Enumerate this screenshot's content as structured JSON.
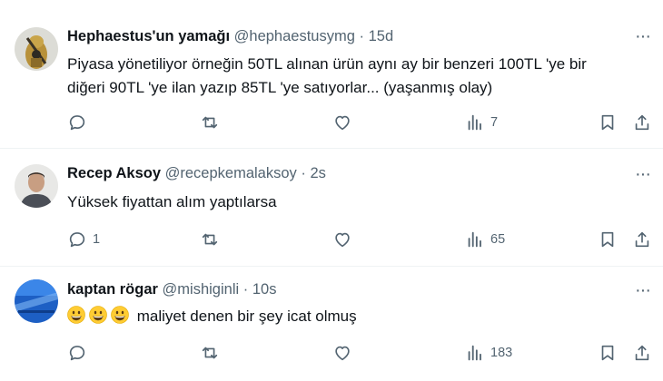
{
  "tweets": [
    {
      "name": "Hephaestus'un yamağı",
      "handle": "@hephaestusymg",
      "separator": "·",
      "time": "15d",
      "text_line1": "Piyasa yönetiliyor örneğin 50TL alınan ürün aynı ay bir benzeri 100TL 'ye bir",
      "text_line2": "diğeri 90TL 'ye ilan yazıp 85TL 'ye satıyorlar... (yaşanmış olay)",
      "replies": "",
      "reposts": "",
      "likes": "",
      "views": "7"
    },
    {
      "name": "Recep Aksoy",
      "handle": "@recepkemalaksoy",
      "separator": "·",
      "time": "2s",
      "text": "Yüksek fiyattan alım yaptılarsa",
      "replies": "1",
      "reposts": "",
      "likes": "",
      "views": "65"
    },
    {
      "name": "kaptan rögar",
      "handle": "@mishiginli",
      "separator": "·",
      "time": "10s",
      "emoji_count": 3,
      "text": "maliyet denen bir şey icat olmuş",
      "replies": "",
      "reposts": "",
      "likes": "",
      "views": "183"
    }
  ],
  "more_label": "···",
  "colors": {
    "text": "#0f1419",
    "secondary": "#536471",
    "divider": "#eff3f4"
  },
  "icons": [
    "reply-icon",
    "repost-icon",
    "like-icon",
    "views-icon",
    "bookmark-icon",
    "share-icon",
    "more-icon",
    "grinning-emoji"
  ]
}
